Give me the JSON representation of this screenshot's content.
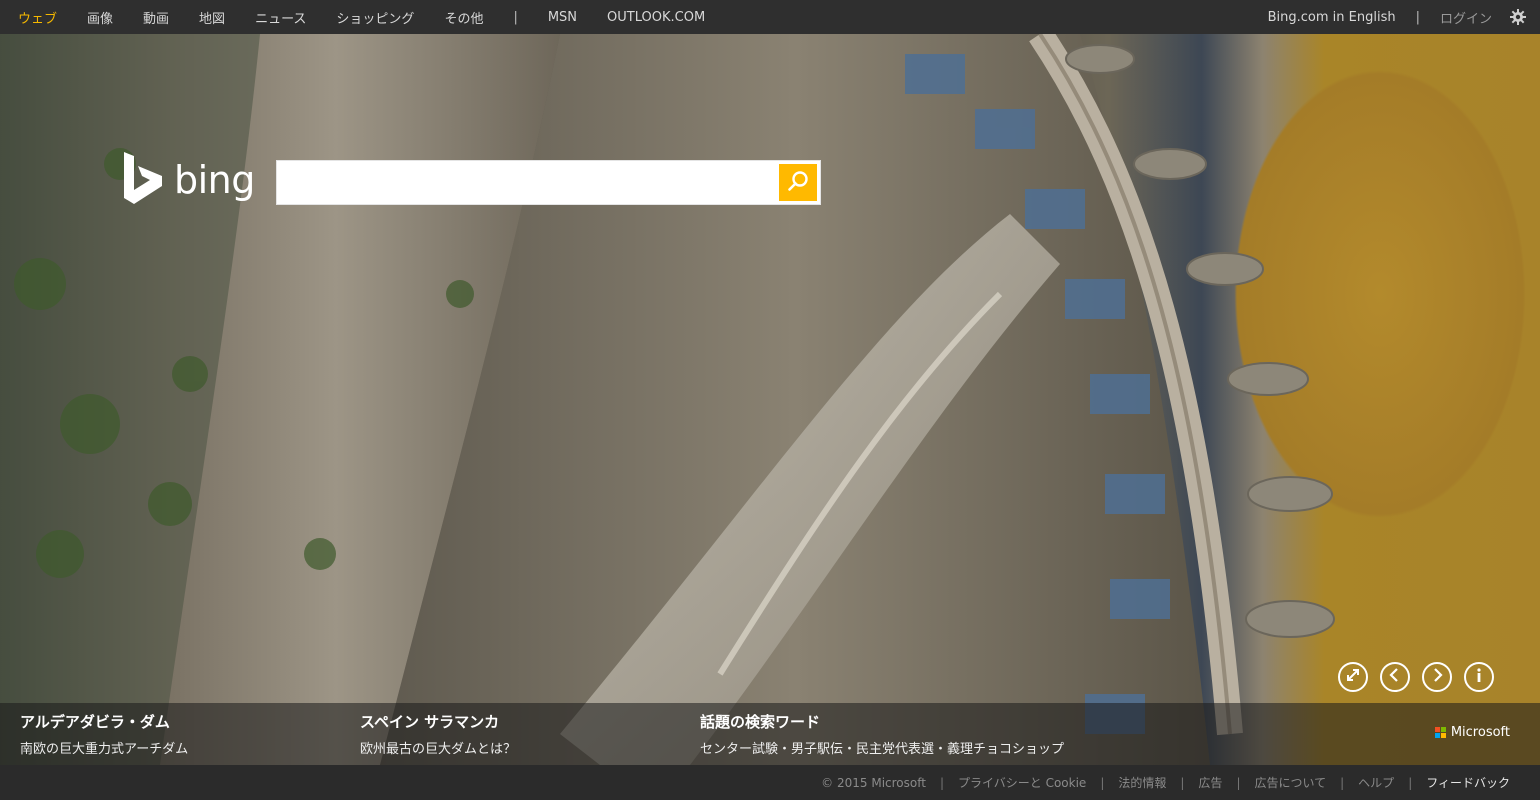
{
  "nav": {
    "items": [
      "ウェブ",
      "画像",
      "動画",
      "地図",
      "ニュース",
      "ショッピング",
      "その他"
    ],
    "separator": "|",
    "extra": [
      "MSN",
      "OUTLOOK.COM"
    ]
  },
  "topright": {
    "english": "Bing.com in English",
    "separator": "|",
    "login": "ログイン"
  },
  "logo": {
    "text": "bing"
  },
  "search": {
    "value": "",
    "placeholder": ""
  },
  "captions": [
    {
      "title": "アルデアダビラ・ダム",
      "subtitle": "南欧の巨大重力式アーチダム"
    },
    {
      "title": "スペイン サラマンカ",
      "subtitle": "欧州最古の巨大ダムとは？"
    },
    {
      "title": "話題の検索ワード",
      "subtitle": "センター試験・男子駅伝・民主党代表選・義理チョコショップ"
    }
  ],
  "brand": {
    "microsoft": "Microsoft",
    "colors": [
      "#f25022",
      "#7fba00",
      "#00a4ef",
      "#ffb900"
    ]
  },
  "footer": {
    "copyright": "© 2015 Microsoft",
    "links": [
      "プライバシーと Cookie",
      "法的情報",
      "広告",
      "広告について",
      "ヘルプ"
    ],
    "feedback": "フィードバック",
    "separator": "|"
  },
  "colors": {
    "accent": "#f5b800",
    "search_button": "#ffb900",
    "topbar": "#2f2f2f"
  },
  "icons": [
    "gear-icon",
    "bing-logo-icon",
    "search-icon",
    "fullscreen-icon",
    "prev-icon",
    "next-icon",
    "info-icon",
    "microsoft-logo-icon"
  ]
}
